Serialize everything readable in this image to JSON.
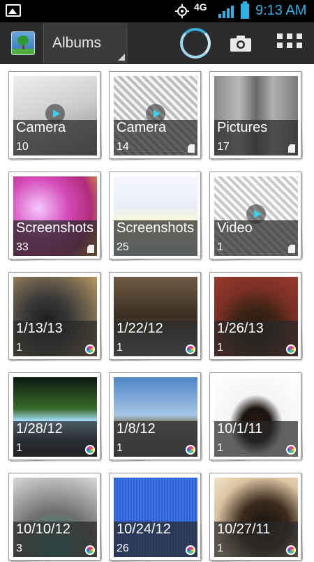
{
  "status_bar": {
    "network": "4G",
    "time": "9:13 AM",
    "accent_color": "#2ab3e6"
  },
  "action_bar": {
    "app_icon": "gallery-app-icon",
    "album_selector_label": "Albums",
    "icons": [
      "loading-spinner",
      "camera-icon",
      "grid-view-icon"
    ]
  },
  "albums": [
    {
      "name": "Camera",
      "count": "10",
      "badge": "none",
      "play": true
    },
    {
      "name": "Camera",
      "count": "14",
      "badge": "sd-card-icon",
      "play": true
    },
    {
      "name": "Pictures",
      "count": "17",
      "badge": "sd-card-icon",
      "play": false
    },
    {
      "name": "Screenshots",
      "count": "33",
      "badge": "sd-card-icon",
      "play": false
    },
    {
      "name": "Screenshots",
      "count": "25",
      "badge": "none",
      "play": false
    },
    {
      "name": "Video",
      "count": "1",
      "badge": "sd-card-icon",
      "play": true
    },
    {
      "name": "1/13/13",
      "count": "1",
      "badge": "picasa-icon",
      "play": false
    },
    {
      "name": "1/22/12",
      "count": "1",
      "badge": "picasa-icon",
      "play": false
    },
    {
      "name": "1/26/13",
      "count": "1",
      "badge": "picasa-icon",
      "play": false
    },
    {
      "name": "1/28/12",
      "count": "1",
      "badge": "picasa-icon",
      "play": false
    },
    {
      "name": "1/8/12",
      "count": "1",
      "badge": "picasa-icon",
      "play": false
    },
    {
      "name": "10/1/11",
      "count": "1",
      "badge": "picasa-icon",
      "play": false
    },
    {
      "name": "10/10/12",
      "count": "3",
      "badge": "picasa-icon",
      "play": false
    },
    {
      "name": "10/24/12",
      "count": "26",
      "badge": "picasa-icon",
      "play": false
    },
    {
      "name": "10/27/11",
      "count": "1",
      "badge": "picasa-icon",
      "play": false
    }
  ]
}
